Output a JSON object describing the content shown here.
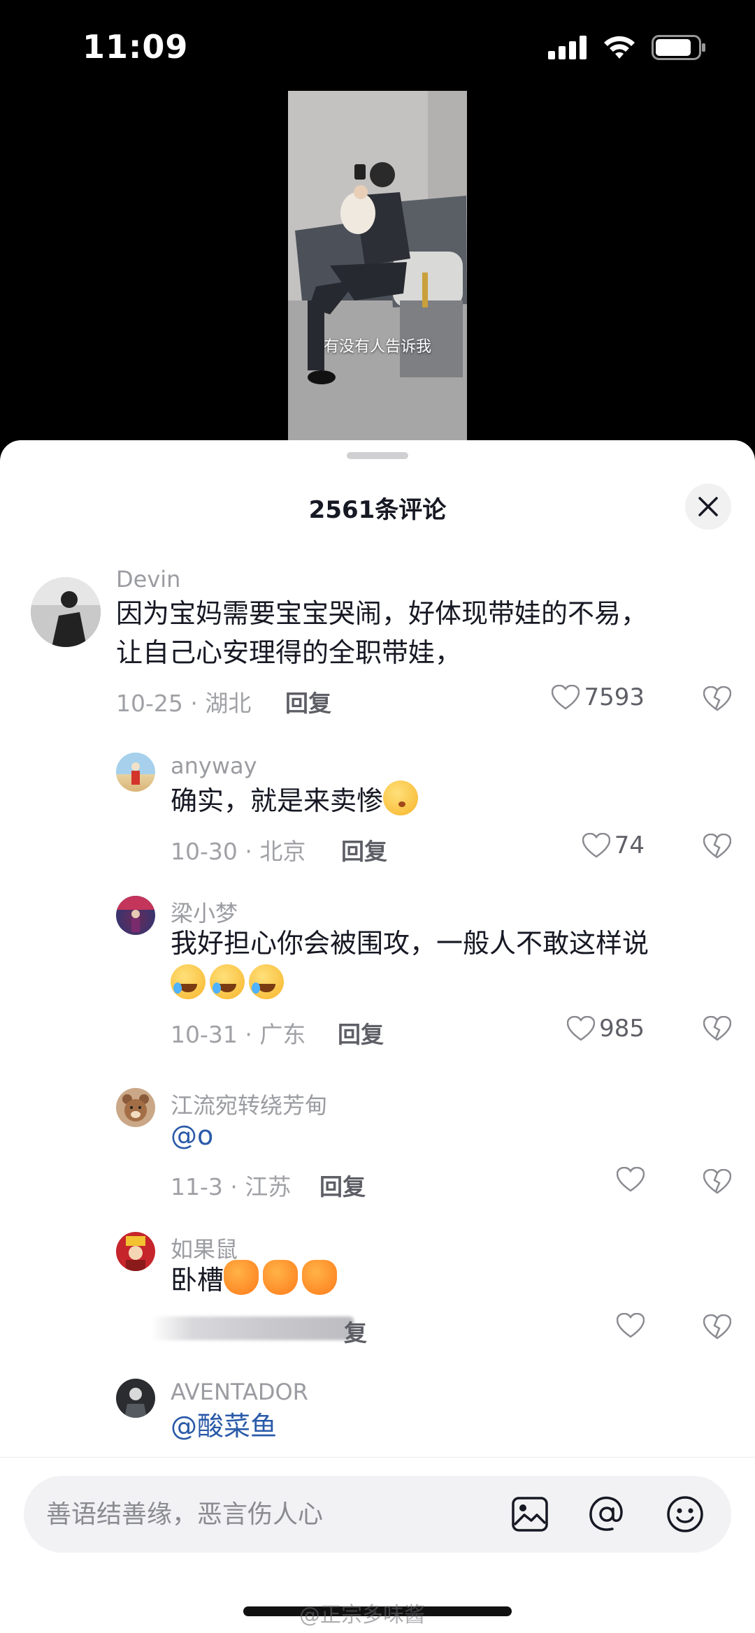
{
  "status_bar": {
    "time": "11:09"
  },
  "video": {
    "caption": "有没有人告诉我"
  },
  "sheet": {
    "title": "2561条评论"
  },
  "comments": [
    {
      "user": "Devin",
      "lines": [
        "因为宝妈需要宝宝哭闹，好体现带娃的不易，",
        "让自己心安理得的全职带娃，"
      ],
      "meta": "10-25 · 湖北",
      "reply": "回复",
      "likes": "7593"
    },
    {
      "user": "anyway",
      "lines": [
        "确实，就是来卖惨"
      ],
      "meta": "10-30 · 北京",
      "reply": "回复",
      "likes": "74"
    },
    {
      "user": "梁小梦",
      "lines": [
        "我好担心你会被围攻，一般人不敢这样说"
      ],
      "meta": "10-31 · 广东",
      "reply": "回复",
      "likes": "985"
    },
    {
      "user": "江流宛转绕芳甸",
      "lines": [
        "@o"
      ],
      "meta": "11-3 · 江苏",
      "reply": "回复",
      "likes": ""
    },
    {
      "user": "如果鼠",
      "lines": [
        "卧槽"
      ],
      "meta": "",
      "reply": "复",
      "likes": ""
    },
    {
      "user": "AVENTADOR",
      "lines": [
        "@酸菜鱼"
      ],
      "meta": "",
      "reply": "",
      "likes": ""
    }
  ],
  "input": {
    "placeholder": "善语结善缘，恶言伤人心"
  },
  "watermark": "@正宗多味酱",
  "colors": {
    "mention": "#2a5aa8",
    "meta": "#a0a1a6",
    "background": "#ffffff"
  },
  "icons": [
    "signal-icon",
    "wifi-icon",
    "battery-icon",
    "close-icon",
    "heart-icon",
    "broken-heart-icon",
    "image-icon",
    "at-icon",
    "emoji-icon"
  ]
}
